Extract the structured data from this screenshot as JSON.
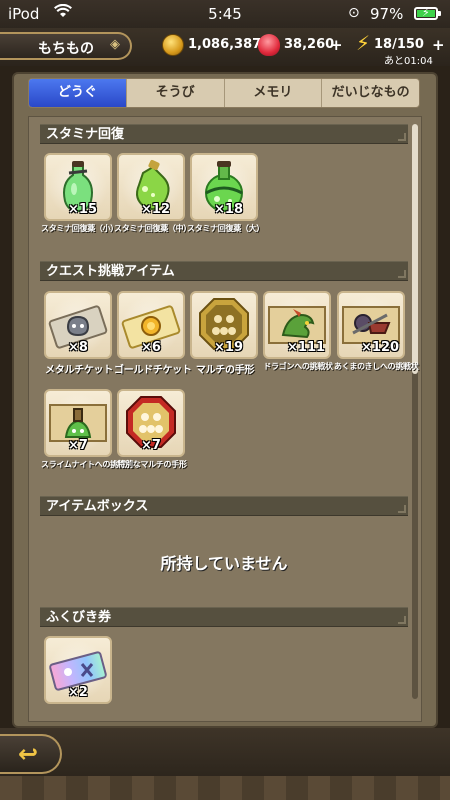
{
  "status": {
    "carrier": "iPod",
    "time": "5:45",
    "battery": "97%"
  },
  "header": {
    "title": "もちもの",
    "gold": "1,086,387",
    "gems": "38,260",
    "stamina": "18/150",
    "stamina_timer": "あと01:04"
  },
  "tabs": [
    {
      "label": "どうぐ",
      "active": true
    },
    {
      "label": "そうび"
    },
    {
      "label": "メモリ"
    },
    {
      "label": "だいじなもの"
    }
  ],
  "sections": {
    "stamina": {
      "title": "スタミナ回復",
      "items": [
        {
          "name": "スタミナ回復薬（小）",
          "count": "×15",
          "icon": "small-potion-icon"
        },
        {
          "name": "スタミナ回復薬（中）",
          "count": "×12",
          "icon": "medium-potion-icon"
        },
        {
          "name": "スタミナ回復薬（大）",
          "count": "×18",
          "icon": "large-potion-icon"
        }
      ]
    },
    "quest": {
      "title": "クエスト挑戦アイテム",
      "items": [
        {
          "name": "メタルチケット",
          "count": "×8",
          "icon": "metal-ticket-icon"
        },
        {
          "name": "ゴールドチケット",
          "count": "×6",
          "icon": "gold-ticket-icon"
        },
        {
          "name": "マルチの手形",
          "count": "×19",
          "icon": "multi-pass-icon"
        },
        {
          "name": "ドラゴンへの挑戦状",
          "count": "×111",
          "icon": "dragon-challenge-icon"
        },
        {
          "name": "あくまのきしへの挑戦状",
          "count": "×120",
          "icon": "demon-knight-challenge-icon"
        },
        {
          "name": "スライムナイトへの挑戦状",
          "count": "×7",
          "icon": "slime-knight-challenge-icon"
        },
        {
          "name": "特別なマルチの手形",
          "count": "×7",
          "icon": "special-multi-pass-icon"
        }
      ]
    },
    "itembox": {
      "title": "アイテムボックス",
      "empty": "所持していません"
    },
    "lottery": {
      "title": "ふくびき券",
      "items": [
        {
          "count": "×2",
          "icon": "lottery-ticket-icon"
        }
      ]
    }
  }
}
